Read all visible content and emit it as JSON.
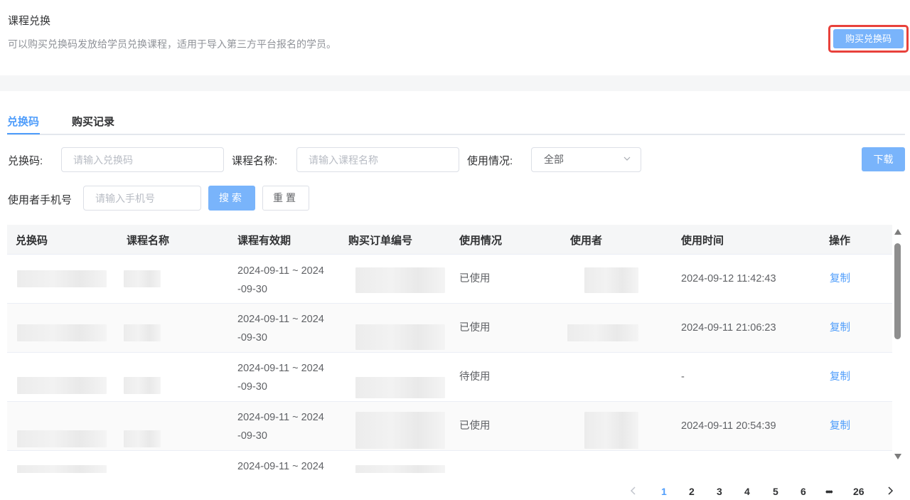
{
  "header": {
    "title": "课程兑换",
    "description": "可以购买兑换码发放给学员兑换课程，适用于导入第三方平台报名的学员。",
    "buy_button": "购买兑换码"
  },
  "tabs": [
    {
      "label": "兑换码",
      "active": true
    },
    {
      "label": "购买记录",
      "active": false
    }
  ],
  "filters": {
    "code_label": "兑换码:",
    "code_placeholder": "请输入兑换码",
    "course_label": "课程名称:",
    "course_placeholder": "请输入课程名称",
    "usage_label": "使用情况:",
    "usage_value": "全部",
    "phone_label": "使用者手机号",
    "phone_placeholder": "请输入手机号",
    "search_button": "搜索",
    "reset_button": "重置",
    "download_button": "下载"
  },
  "table": {
    "columns": [
      "兑换码",
      "课程名称",
      "课程有效期",
      "购买订单编号",
      "使用情况",
      "使用者",
      "使用时间",
      "操作"
    ],
    "rows": [
      {
        "validity_1": "2024-09-11 ~ 2024",
        "validity_2": "-09-30",
        "status": "已使用",
        "used_time": "2024-09-12 11:42:43",
        "action": "复制"
      },
      {
        "validity_1": "2024-09-11 ~ 2024",
        "validity_2": "-09-30",
        "status": "已使用",
        "used_time": "2024-09-11 21:06:23",
        "action": "复制"
      },
      {
        "validity_1": "2024-09-11 ~ 2024",
        "validity_2": "-09-30",
        "status": "待使用",
        "used_time": "-",
        "action": "复制"
      },
      {
        "validity_1": "2024-09-11 ~ 2024",
        "validity_2": "-09-30",
        "status": "已使用",
        "used_time": "2024-09-11 20:54:39",
        "action": "复制"
      },
      {
        "validity_1": "2024-09-11 ~ 2024",
        "validity_2": "",
        "status": "",
        "used_time": "",
        "action": ""
      }
    ]
  },
  "pagination": {
    "pages": [
      "1",
      "2",
      "3",
      "4",
      "5",
      "6",
      "•••",
      "26"
    ],
    "current": "1"
  },
  "colors": {
    "primary": "#79b4fb",
    "link": "#4f9dfb",
    "highlight_border": "#e8413b"
  }
}
